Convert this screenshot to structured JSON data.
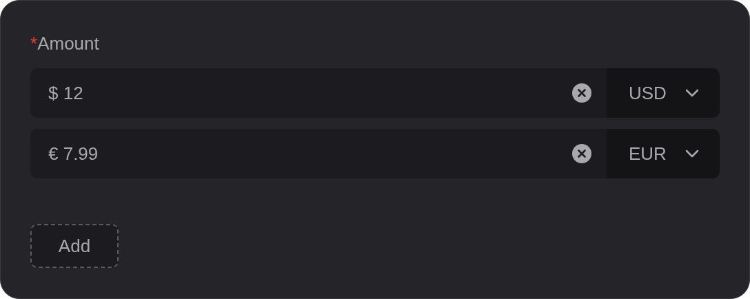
{
  "field": {
    "required_mark": "*",
    "label": "Amount"
  },
  "rows": [
    {
      "value": "$ 12",
      "currency": "USD"
    },
    {
      "value": "€ 7.99",
      "currency": "EUR"
    }
  ],
  "add_button": "Add"
}
